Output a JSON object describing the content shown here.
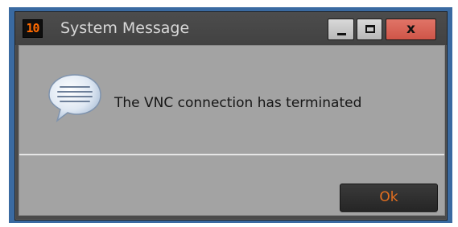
{
  "window": {
    "app_icon_text": "10",
    "title": "System Message",
    "close_label": "x"
  },
  "dialog": {
    "message": "The VNC connection has terminated",
    "icon": "speech-bubble-icon",
    "ok_label": "Ok"
  },
  "colors": {
    "desktop_frame": "#3a6aa1",
    "titlebar": "#464646",
    "client_bg": "#a3a3a3",
    "close_button": "#d65e51",
    "ok_text": "#e46f1f",
    "app_icon_text": "#ff6a00"
  }
}
